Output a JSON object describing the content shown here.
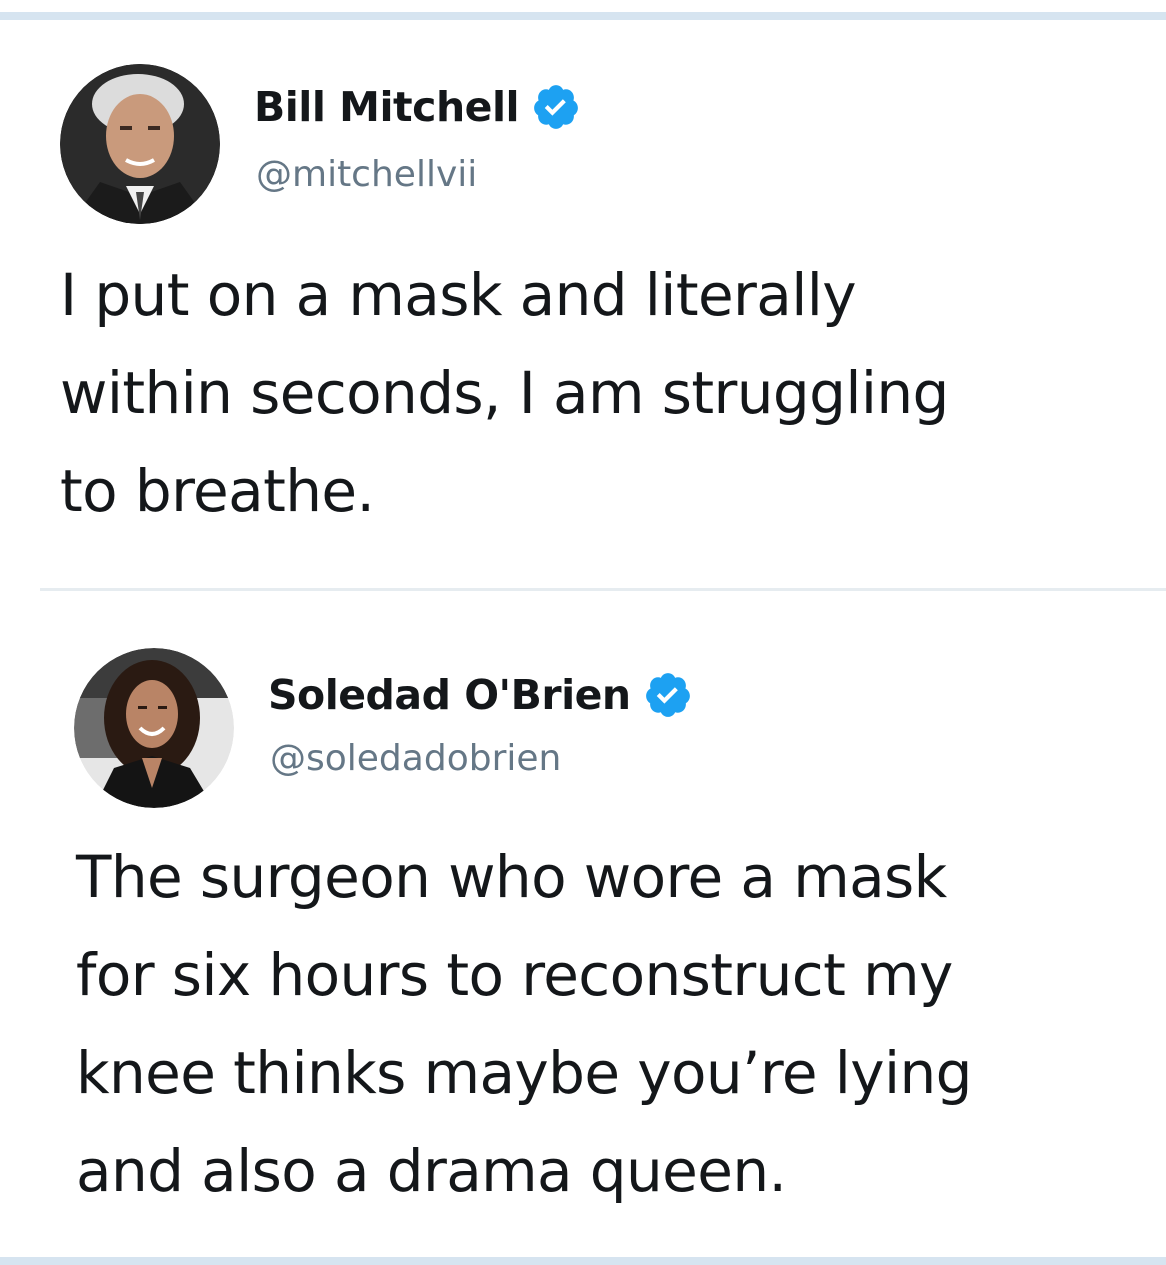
{
  "colors": {
    "verified": "#1da1f2",
    "handle": "#657786",
    "text": "#14171a",
    "divider": "#e6ecf0",
    "frame": "#d6e4f0"
  },
  "tweets": [
    {
      "display_name": "Bill Mitchell",
      "handle": "@mitchellvii",
      "verified": true,
      "avatar_icon": "avatar-man-gray-hair",
      "text_lines": [
        "I put on a mask and literally",
        "within seconds, I am struggling",
        "to breathe."
      ]
    },
    {
      "display_name": "Soledad O'Brien",
      "handle": "@soledadobrien",
      "verified": true,
      "avatar_icon": "avatar-woman-dark-hair",
      "text_lines": [
        "The surgeon who wore a mask",
        "for six hours to reconstruct my",
        "knee thinks maybe you’re lying",
        "and also a drama queen."
      ]
    }
  ]
}
